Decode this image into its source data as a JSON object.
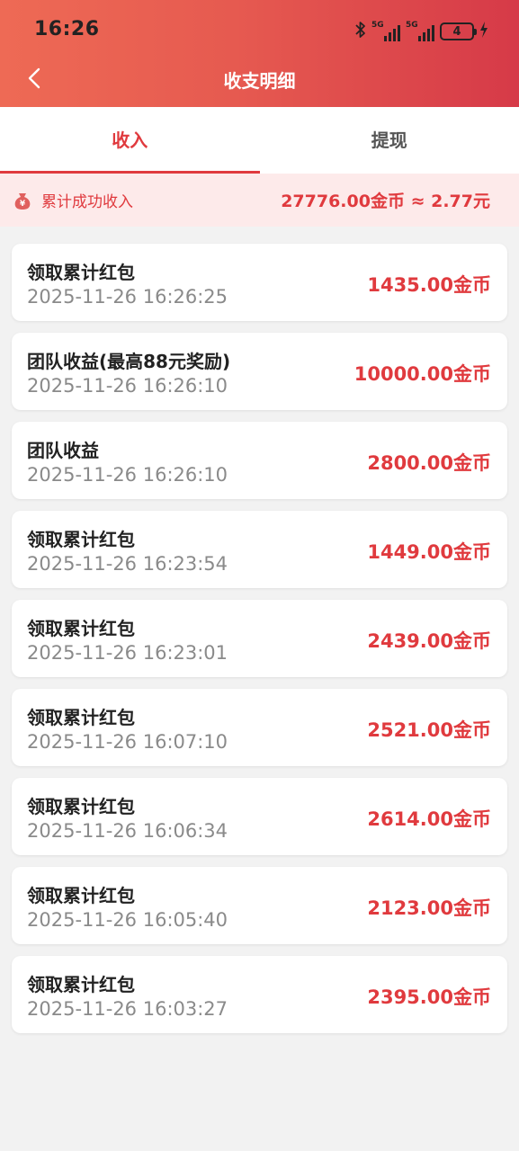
{
  "status": {
    "time": "16:26",
    "network1": "5G",
    "network2": "5G",
    "battery": "4"
  },
  "nav": {
    "title": "收支明细"
  },
  "tabs": [
    {
      "label": "收入",
      "active": true
    },
    {
      "label": "提现",
      "active": false
    }
  ],
  "summary": {
    "label": "累计成功收入",
    "value": "27776.00金币 ≈ 2.77元"
  },
  "records": [
    {
      "title": "领取累计红包",
      "time": "2025-11-26 16:26:25",
      "amount": "1435.00金币"
    },
    {
      "title": "团队收益(最高88元奖励)",
      "time": "2025-11-26 16:26:10",
      "amount": "10000.00金币"
    },
    {
      "title": "团队收益",
      "time": "2025-11-26 16:26:10",
      "amount": "2800.00金币"
    },
    {
      "title": "领取累计红包",
      "time": "2025-11-26 16:23:54",
      "amount": "1449.00金币"
    },
    {
      "title": "领取累计红包",
      "time": "2025-11-26 16:23:01",
      "amount": "2439.00金币"
    },
    {
      "title": "领取累计红包",
      "time": "2025-11-26 16:07:10",
      "amount": "2521.00金币"
    },
    {
      "title": "领取累计红包",
      "time": "2025-11-26 16:06:34",
      "amount": "2614.00金币"
    },
    {
      "title": "领取累计红包",
      "time": "2025-11-26 16:05:40",
      "amount": "2123.00金币"
    },
    {
      "title": "领取累计红包",
      "time": "2025-11-26 16:03:27",
      "amount": "2395.00金币"
    }
  ],
  "colors": {
    "accent": "#e03a3e",
    "header_start": "#ee6a55",
    "header_end": "#d63a48",
    "summary_bg": "#fdeaea"
  },
  "icons": {
    "back": "chevron-left-icon",
    "bluetooth": "bluetooth-icon",
    "charging": "lightning-icon",
    "summary": "money-bag-icon"
  }
}
